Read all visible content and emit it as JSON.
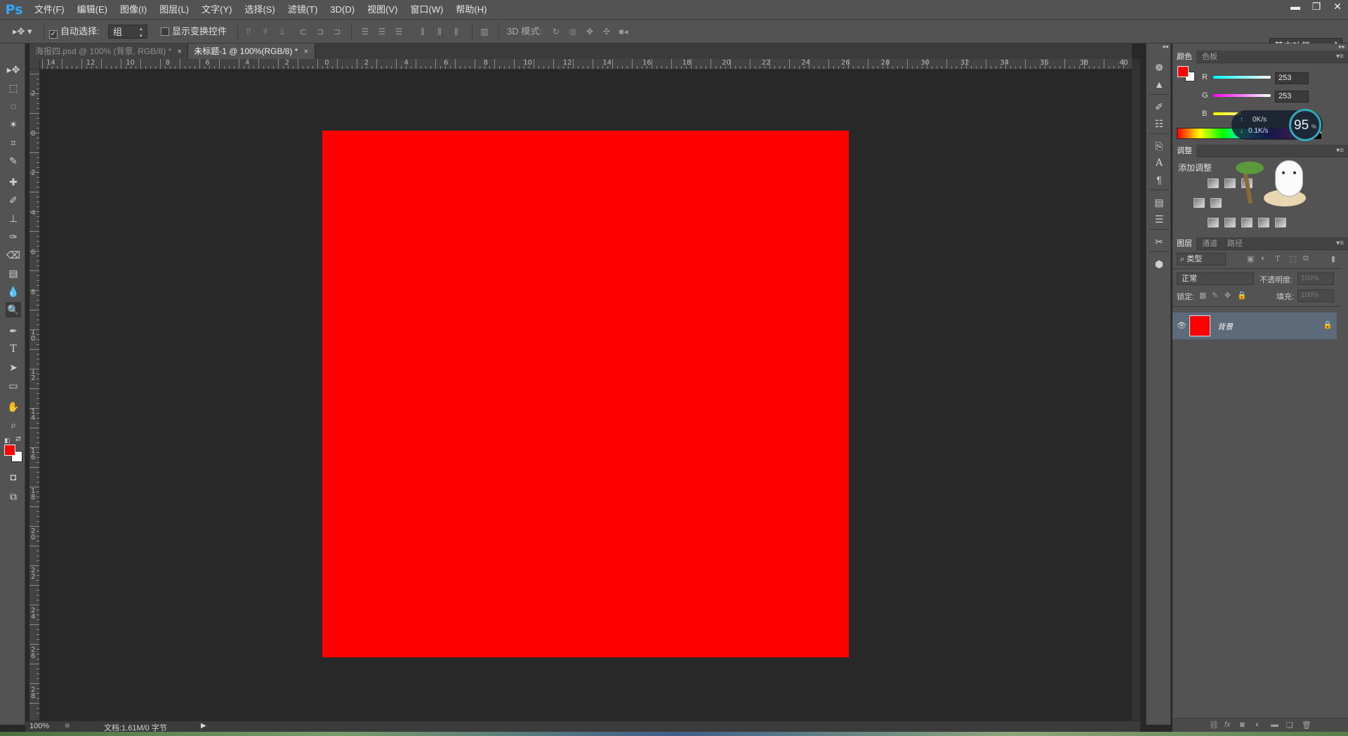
{
  "app": {
    "logo": "Ps"
  },
  "menu": [
    "文件(F)",
    "编辑(E)",
    "图像(I)",
    "图层(L)",
    "文字(Y)",
    "选择(S)",
    "滤镜(T)",
    "3D(D)",
    "视图(V)",
    "窗口(W)",
    "帮助(H)"
  ],
  "window_controls": {
    "minimize": "▬",
    "restore": "❐",
    "close": "✕"
  },
  "options_bar": {
    "move_tool_icon": "move-icon",
    "auto_select_label": "自动选择:",
    "auto_select_checked": true,
    "auto_select_value": "组",
    "show_transform_label": "显示变换控件",
    "show_transform_checked": false,
    "mode_3d_label": "3D 模式:",
    "workspace_value": "基本功能"
  },
  "tabs": [
    {
      "title": "海报四.psd @ 100% (背景, RGB/8) *",
      "close": "×",
      "active": false
    },
    {
      "title": "未标题-1 @ 100%(RGB/8) *",
      "close": "×",
      "active": true
    }
  ],
  "ruler_top_labels": [
    "14",
    "12",
    "10",
    "8",
    "6",
    "4",
    "2",
    "0",
    "2",
    "4",
    "6",
    "8",
    "10",
    "12",
    "14",
    "16",
    "18",
    "20",
    "22",
    "24",
    "26",
    "28",
    "30",
    "32",
    "34",
    "36",
    "38",
    "40"
  ],
  "ruler_left_labels": [
    "2",
    "0",
    "2",
    "4",
    "6",
    "8",
    "10",
    "12",
    "14",
    "16",
    "18",
    "20",
    "22",
    "24",
    "26",
    "28"
  ],
  "document": {
    "fill_color": "#ff0000"
  },
  "status": {
    "zoom": "100%",
    "doc_info": "文档:1.61M/0 字节"
  },
  "color_panel": {
    "tabs": [
      "颜色",
      "色板"
    ],
    "fg_color": "#ff0000",
    "bg_color": "#ffffff",
    "channels": [
      {
        "label": "R",
        "value": "253"
      },
      {
        "label": "G",
        "value": "253"
      },
      {
        "label": "B",
        "value": ""
      }
    ],
    "net_widget": {
      "up": "0K/s",
      "down": "0.1K/s",
      "percent": "95",
      "percent_sign": "%"
    }
  },
  "adjust_panel": {
    "tabs": [
      "调整"
    ],
    "title": "添加调整"
  },
  "layers_panel": {
    "tabs": [
      "图层",
      "通道",
      "路径"
    ],
    "filter_label": "类型",
    "blend_mode": "正常",
    "opacity_label": "不透明度:",
    "opacity_value": "100%",
    "lock_label": "锁定:",
    "fill_label": "填充:",
    "fill_value": "100%",
    "layers": [
      {
        "name": "背景",
        "thumb_color": "#ff0000",
        "visible": true,
        "locked": true
      }
    ]
  }
}
